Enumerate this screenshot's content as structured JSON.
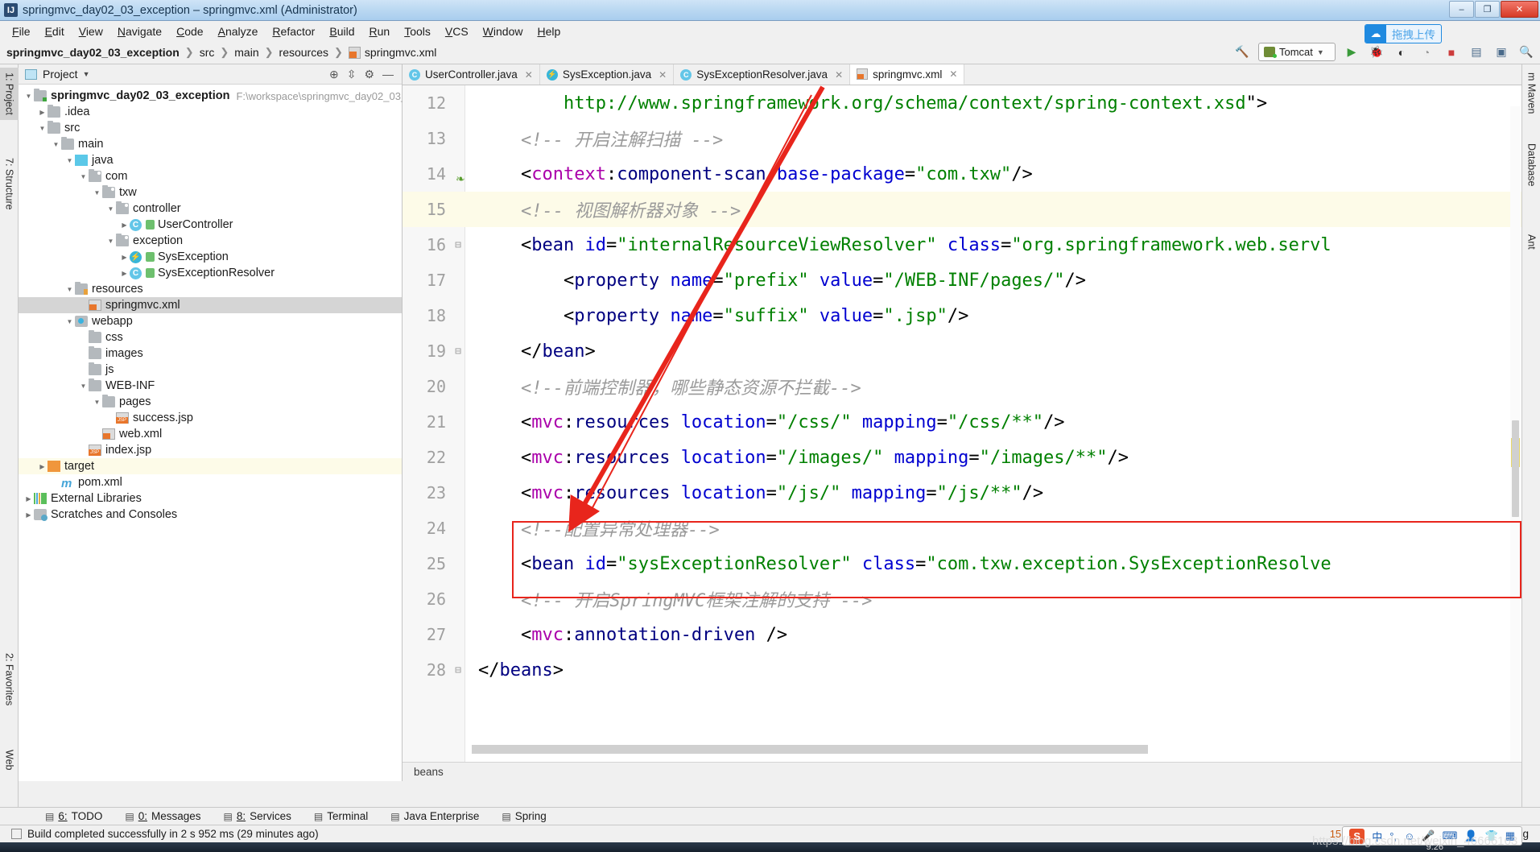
{
  "window": {
    "title": "springmvc_day02_03_exception – springmvc.xml (Administrator)",
    "app_icon": "idea-icon",
    "minimize": "–",
    "maximize": "❐",
    "close": "✕"
  },
  "menu": {
    "items": [
      "File",
      "Edit",
      "View",
      "Navigate",
      "Code",
      "Analyze",
      "Refactor",
      "Build",
      "Run",
      "Tools",
      "VCS",
      "Window",
      "Help"
    ]
  },
  "breadcrumb": {
    "items": [
      "springmvc_day02_03_exception",
      "src",
      "main",
      "resources",
      "springmvc.xml"
    ]
  },
  "toolbar": {
    "run_config": "Tomcat",
    "upload_badge": "拖拽上传",
    "icons": [
      "build-icon",
      "run-icon",
      "debug-icon",
      "run-with-coverage-icon",
      "profile-icon",
      "stop-icon",
      "open-project-structure-icon",
      "select-in-icon",
      "search-everywhere-icon"
    ]
  },
  "left_strips": {
    "top": [
      {
        "label": "1: Project",
        "selected": true
      },
      {
        "label": "7: Structure",
        "selected": false
      }
    ],
    "bottom": [
      {
        "label": "2: Favorites",
        "selected": false
      },
      {
        "label": "Web",
        "selected": false
      }
    ]
  },
  "right_strips": {
    "items": [
      "m Maven",
      "Database",
      "Ant"
    ]
  },
  "project_panel": {
    "header": "Project",
    "tree": [
      {
        "indent": 0,
        "arrow": "down",
        "icon": "folder-src",
        "label": "springmvc_day02_03_exception",
        "bold": true,
        "note": "F:\\workspace\\springmvc_day02_03_exce",
        "selected": false
      },
      {
        "indent": 1,
        "arrow": "right",
        "icon": "folder",
        "label": ".idea",
        "bold": false,
        "note": "",
        "selected": false
      },
      {
        "indent": 1,
        "arrow": "down",
        "icon": "folder",
        "label": "src",
        "bold": false,
        "note": "",
        "selected": false
      },
      {
        "indent": 2,
        "arrow": "down",
        "icon": "folder",
        "label": "main",
        "bold": false,
        "note": "",
        "selected": false
      },
      {
        "indent": 3,
        "arrow": "down",
        "icon": "folder-java",
        "label": "java",
        "bold": false,
        "note": "",
        "selected": false
      },
      {
        "indent": 4,
        "arrow": "down",
        "icon": "folder-pkg",
        "label": "com",
        "bold": false,
        "note": "",
        "selected": false
      },
      {
        "indent": 5,
        "arrow": "down",
        "icon": "folder-pkg",
        "label": "txw",
        "bold": false,
        "note": "",
        "selected": false
      },
      {
        "indent": 6,
        "arrow": "down",
        "icon": "folder-pkg",
        "label": "controller",
        "bold": false,
        "note": "",
        "selected": false
      },
      {
        "indent": 7,
        "arrow": "right",
        "icon": "class",
        "label": "UserController",
        "bold": false,
        "note": "",
        "selected": false
      },
      {
        "indent": 6,
        "arrow": "down",
        "icon": "folder-pkg",
        "label": "exception",
        "bold": false,
        "note": "",
        "selected": false
      },
      {
        "indent": 7,
        "arrow": "right",
        "icon": "exception",
        "label": "SysException",
        "bold": false,
        "note": "",
        "selected": false
      },
      {
        "indent": 7,
        "arrow": "right",
        "icon": "class",
        "label": "SysExceptionResolver",
        "bold": false,
        "note": "",
        "selected": false
      },
      {
        "indent": 3,
        "arrow": "down",
        "icon": "folder-res",
        "label": "resources",
        "bold": false,
        "note": "",
        "selected": false
      },
      {
        "indent": 4,
        "arrow": "none",
        "icon": "xml-file",
        "label": "springmvc.xml",
        "bold": false,
        "note": "",
        "selected": true
      },
      {
        "indent": 3,
        "arrow": "down",
        "icon": "folder-web",
        "label": "webapp",
        "bold": false,
        "note": "",
        "selected": false
      },
      {
        "indent": 4,
        "arrow": "none",
        "icon": "folder",
        "label": "css",
        "bold": false,
        "note": "",
        "selected": false
      },
      {
        "indent": 4,
        "arrow": "none",
        "icon": "folder",
        "label": "images",
        "bold": false,
        "note": "",
        "selected": false
      },
      {
        "indent": 4,
        "arrow": "none",
        "icon": "folder",
        "label": "js",
        "bold": false,
        "note": "",
        "selected": false
      },
      {
        "indent": 4,
        "arrow": "down",
        "icon": "folder",
        "label": "WEB-INF",
        "bold": false,
        "note": "",
        "selected": false
      },
      {
        "indent": 5,
        "arrow": "down",
        "icon": "folder",
        "label": "pages",
        "bold": false,
        "note": "",
        "selected": false
      },
      {
        "indent": 6,
        "arrow": "none",
        "icon": "jsp-file",
        "label": "success.jsp",
        "bold": false,
        "note": "",
        "selected": false
      },
      {
        "indent": 5,
        "arrow": "none",
        "icon": "xml-file",
        "label": "web.xml",
        "bold": false,
        "note": "",
        "selected": false
      },
      {
        "indent": 4,
        "arrow": "none",
        "icon": "jsp-file",
        "label": "index.jsp",
        "bold": false,
        "note": "",
        "selected": false
      },
      {
        "indent": 1,
        "arrow": "right",
        "icon": "folder-orange",
        "label": "target",
        "bold": false,
        "note": "",
        "selected": false,
        "highlight": true
      },
      {
        "indent": 2,
        "arrow": "none",
        "icon": "maven-file",
        "label": "pom.xml",
        "bold": false,
        "note": "",
        "selected": false
      },
      {
        "indent": 0,
        "arrow": "right",
        "icon": "libraries",
        "label": "External Libraries",
        "bold": false,
        "note": "",
        "selected": false
      },
      {
        "indent": 0,
        "arrow": "right",
        "icon": "scratches",
        "label": "Scratches and Consoles",
        "bold": false,
        "note": "",
        "selected": false
      }
    ]
  },
  "editor": {
    "tabs": [
      {
        "label": "UserController.java",
        "icon": "class-icon",
        "active": false
      },
      {
        "label": "SysException.java",
        "icon": "exception-icon",
        "active": false
      },
      {
        "label": "SysExceptionResolver.java",
        "icon": "class-icon",
        "active": false
      },
      {
        "label": "springmvc.xml",
        "icon": "xml-icon",
        "active": true
      }
    ],
    "status_breadcrumb": "beans",
    "lines": [
      {
        "num": "12",
        "fold": "",
        "highlight": false,
        "tokens": [
          {
            "t": "        ",
            "c": "plain"
          },
          {
            "t": "http://www.springframework.org/schema/context/spring-context.xsd",
            "c": "str"
          },
          {
            "t": "\">",
            "c": "brk"
          }
        ]
      },
      {
        "num": "13",
        "fold": "",
        "highlight": false,
        "tokens": [
          {
            "t": "    ",
            "c": "plain"
          },
          {
            "t": "<!-- 开启注解扫描 -->",
            "c": "cmt"
          }
        ]
      },
      {
        "num": "14",
        "fold": "",
        "highlight": false,
        "gutter_mark": "bean-icon",
        "tokens": [
          {
            "t": "    ",
            "c": "plain"
          },
          {
            "t": "<",
            "c": "brk"
          },
          {
            "t": "context",
            "c": "ns"
          },
          {
            "t": ":",
            "c": "brk"
          },
          {
            "t": "component-scan ",
            "c": "tag"
          },
          {
            "t": "base-package",
            "c": "attr"
          },
          {
            "t": "=",
            "c": "brk"
          },
          {
            "t": "\"com.txw\"",
            "c": "str"
          },
          {
            "t": "/>",
            "c": "brk"
          }
        ]
      },
      {
        "num": "15",
        "fold": "",
        "highlight": true,
        "tokens": [
          {
            "t": "    ",
            "c": "plain"
          },
          {
            "t": "<!-- 视图解析器对象 -->",
            "c": "cmt"
          }
        ]
      },
      {
        "num": "16",
        "fold": "minus",
        "highlight": false,
        "tokens": [
          {
            "t": "    ",
            "c": "plain"
          },
          {
            "t": "<",
            "c": "brk"
          },
          {
            "t": "bean ",
            "c": "tag"
          },
          {
            "t": "id",
            "c": "attr"
          },
          {
            "t": "=",
            "c": "brk"
          },
          {
            "t": "\"internalResourceViewResolver\"",
            "c": "str"
          },
          {
            "t": " ",
            "c": "plain"
          },
          {
            "t": "class",
            "c": "attr"
          },
          {
            "t": "=",
            "c": "brk"
          },
          {
            "t": "\"org.springframework.web.servl",
            "c": "str"
          }
        ]
      },
      {
        "num": "17",
        "fold": "",
        "highlight": false,
        "tokens": [
          {
            "t": "        ",
            "c": "plain"
          },
          {
            "t": "<",
            "c": "brk"
          },
          {
            "t": "property ",
            "c": "tag"
          },
          {
            "t": "name",
            "c": "attr"
          },
          {
            "t": "=",
            "c": "brk"
          },
          {
            "t": "\"prefix\"",
            "c": "str"
          },
          {
            "t": " ",
            "c": "plain"
          },
          {
            "t": "value",
            "c": "attr"
          },
          {
            "t": "=",
            "c": "brk"
          },
          {
            "t": "\"/WEB-INF/pages/\"",
            "c": "str"
          },
          {
            "t": "/>",
            "c": "brk"
          }
        ]
      },
      {
        "num": "18",
        "fold": "",
        "highlight": false,
        "tokens": [
          {
            "t": "        ",
            "c": "plain"
          },
          {
            "t": "<",
            "c": "brk"
          },
          {
            "t": "property ",
            "c": "tag"
          },
          {
            "t": "name",
            "c": "attr"
          },
          {
            "t": "=",
            "c": "brk"
          },
          {
            "t": "\"suffix\"",
            "c": "str"
          },
          {
            "t": " ",
            "c": "plain"
          },
          {
            "t": "value",
            "c": "attr"
          },
          {
            "t": "=",
            "c": "brk"
          },
          {
            "t": "\".jsp\"",
            "c": "str"
          },
          {
            "t": "/>",
            "c": "brk"
          }
        ]
      },
      {
        "num": "19",
        "fold": "minus",
        "highlight": false,
        "tokens": [
          {
            "t": "    ",
            "c": "plain"
          },
          {
            "t": "</",
            "c": "brk"
          },
          {
            "t": "bean",
            "c": "tag"
          },
          {
            "t": ">",
            "c": "brk"
          }
        ]
      },
      {
        "num": "20",
        "fold": "",
        "highlight": false,
        "tokens": [
          {
            "t": "    ",
            "c": "plain"
          },
          {
            "t": "<!--前端控制器，哪些静态资源不拦截-->",
            "c": "cmt"
          }
        ]
      },
      {
        "num": "21",
        "fold": "",
        "highlight": false,
        "tokens": [
          {
            "t": "    ",
            "c": "plain"
          },
          {
            "t": "<",
            "c": "brk"
          },
          {
            "t": "mvc",
            "c": "ns"
          },
          {
            "t": ":",
            "c": "brk"
          },
          {
            "t": "resources ",
            "c": "tag"
          },
          {
            "t": "location",
            "c": "attr"
          },
          {
            "t": "=",
            "c": "brk"
          },
          {
            "t": "\"/css/\"",
            "c": "str"
          },
          {
            "t": " ",
            "c": "plain"
          },
          {
            "t": "mapping",
            "c": "attr"
          },
          {
            "t": "=",
            "c": "brk"
          },
          {
            "t": "\"/css/**\"",
            "c": "str"
          },
          {
            "t": "/>",
            "c": "brk"
          }
        ]
      },
      {
        "num": "22",
        "fold": "",
        "highlight": false,
        "tokens": [
          {
            "t": "    ",
            "c": "plain"
          },
          {
            "t": "<",
            "c": "brk"
          },
          {
            "t": "mvc",
            "c": "ns"
          },
          {
            "t": ":",
            "c": "brk"
          },
          {
            "t": "resources ",
            "c": "tag"
          },
          {
            "t": "location",
            "c": "attr"
          },
          {
            "t": "=",
            "c": "brk"
          },
          {
            "t": "\"/images/\"",
            "c": "str"
          },
          {
            "t": " ",
            "c": "plain"
          },
          {
            "t": "mapping",
            "c": "attr"
          },
          {
            "t": "=",
            "c": "brk"
          },
          {
            "t": "\"/images/**\"",
            "c": "str"
          },
          {
            "t": "/>",
            "c": "brk"
          }
        ]
      },
      {
        "num": "23",
        "fold": "",
        "highlight": false,
        "tokens": [
          {
            "t": "    ",
            "c": "plain"
          },
          {
            "t": "<",
            "c": "brk"
          },
          {
            "t": "mvc",
            "c": "ns"
          },
          {
            "t": ":",
            "c": "brk"
          },
          {
            "t": "resources ",
            "c": "tag"
          },
          {
            "t": "location",
            "c": "attr"
          },
          {
            "t": "=",
            "c": "brk"
          },
          {
            "t": "\"/js/\"",
            "c": "str"
          },
          {
            "t": " ",
            "c": "plain"
          },
          {
            "t": "mapping",
            "c": "attr"
          },
          {
            "t": "=",
            "c": "brk"
          },
          {
            "t": "\"/js/**\"",
            "c": "str"
          },
          {
            "t": "/>",
            "c": "brk"
          }
        ]
      },
      {
        "num": "24",
        "fold": "",
        "highlight": false,
        "tokens": [
          {
            "t": "    ",
            "c": "plain"
          },
          {
            "t": "<!--配置异常处理器-->",
            "c": "cmt"
          }
        ]
      },
      {
        "num": "25",
        "fold": "",
        "highlight": false,
        "tokens": [
          {
            "t": "    ",
            "c": "plain"
          },
          {
            "t": "<",
            "c": "brk"
          },
          {
            "t": "bean ",
            "c": "tag"
          },
          {
            "t": "id",
            "c": "attr"
          },
          {
            "t": "=",
            "c": "brk"
          },
          {
            "t": "\"sysExceptionResolver\"",
            "c": "str"
          },
          {
            "t": " ",
            "c": "plain"
          },
          {
            "t": "class",
            "c": "attr"
          },
          {
            "t": "=",
            "c": "brk"
          },
          {
            "t": "\"com.txw.exception.SysExceptionResolve",
            "c": "str"
          }
        ]
      },
      {
        "num": "26",
        "fold": "",
        "highlight": false,
        "tokens": [
          {
            "t": "    ",
            "c": "plain"
          },
          {
            "t": "<!-- 开启SpringMVC框架注解的支持 -->",
            "c": "cmt"
          }
        ]
      },
      {
        "num": "27",
        "fold": "",
        "highlight": false,
        "tokens": [
          {
            "t": "    ",
            "c": "plain"
          },
          {
            "t": "<",
            "c": "brk"
          },
          {
            "t": "mvc",
            "c": "ns"
          },
          {
            "t": ":",
            "c": "brk"
          },
          {
            "t": "annotation-driven ",
            "c": "tag"
          },
          {
            "t": "/>",
            "c": "brk"
          }
        ]
      },
      {
        "num": "28",
        "fold": "minus",
        "highlight": false,
        "tokens": [
          {
            "t": "",
            "c": "plain"
          },
          {
            "t": "</",
            "c": "brk"
          },
          {
            "t": "beans",
            "c": "tag"
          },
          {
            "t": ">",
            "c": "brk"
          }
        ]
      }
    ]
  },
  "bottom_tools": [
    {
      "num": "6",
      "label": "TODO",
      "icon": "todo-icon"
    },
    {
      "num": "0",
      "label": "Messages",
      "icon": "messages-icon"
    },
    {
      "num": "8",
      "label": "Services",
      "icon": "services-icon"
    },
    {
      "num": "",
      "label": "Terminal",
      "icon": "terminal-icon"
    },
    {
      "num": "",
      "label": "Java Enterprise",
      "icon": "java-enterprise-icon"
    },
    {
      "num": "",
      "label": "Spring",
      "icon": "spring-icon"
    }
  ],
  "status_bar": {
    "message": "Build completed successfully in 2 s 952 ms (29 minutes ago)",
    "event_log": "Event Log",
    "event_count": "1"
  },
  "system_tray": {
    "time": "15:1",
    "clock": "9:26",
    "ime_lang": "中",
    "ime_punct": "°,",
    "icons": [
      "sogou-icon",
      "smiley-icon",
      "microphone-icon",
      "keyboard-icon",
      "user-icon",
      "shirt-icon",
      "grid-icon"
    ]
  },
  "watermark": "https://blog.csdn.net/weixin_46666163",
  "colors": {
    "accent_blue": "#1f8ae0",
    "annotation_red": "#e8251c",
    "string_green": "#008000",
    "tag_navy": "#000080",
    "attr_blue": "#0000d0",
    "ns_magenta": "#aa00aa",
    "comment_gray": "#9a9a9a",
    "highlight_line": "#fdfbe8"
  }
}
